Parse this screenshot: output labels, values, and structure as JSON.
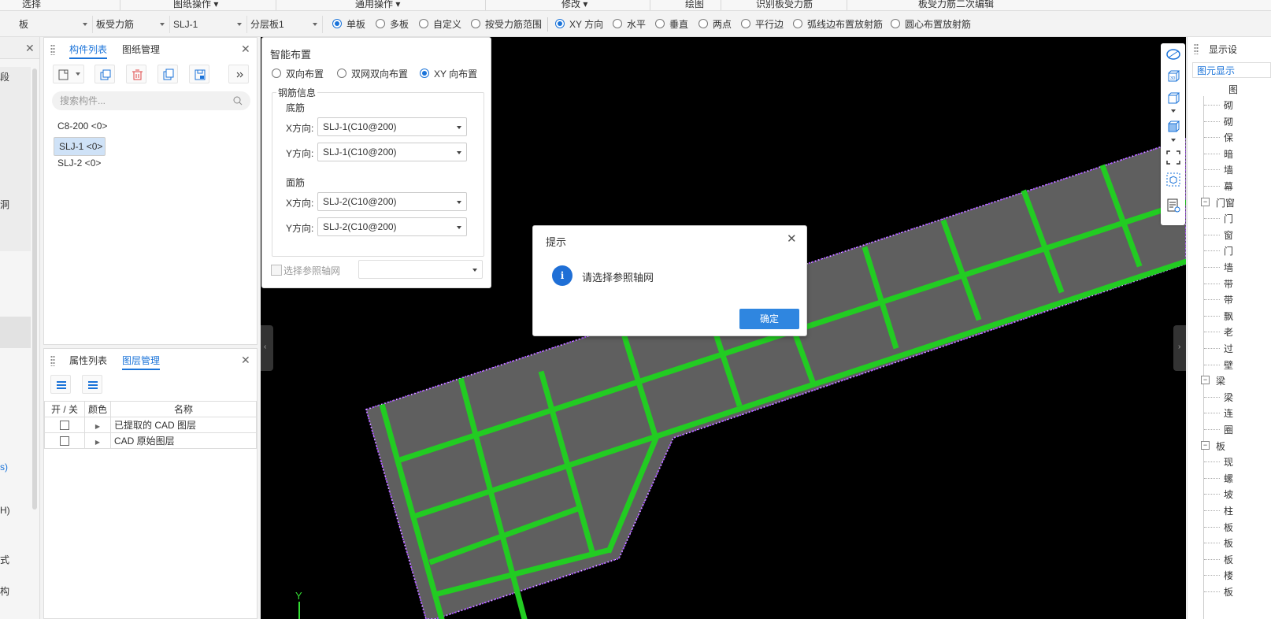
{
  "ribbon": {
    "groups": [
      "选择",
      "图纸操作 ▾",
      "通用操作 ▾",
      "修改 ▾",
      "绘图",
      "识别板受力筋",
      "板受力筋二次编辑"
    ]
  },
  "parambar": {
    "combo1": "板",
    "combo2": "板受力筋",
    "combo3": "SLJ-1",
    "combo4": "分层板1",
    "radios1": [
      {
        "label": "单板",
        "checked": true
      },
      {
        "label": "多板",
        "checked": false
      },
      {
        "label": "自定义",
        "checked": false
      },
      {
        "label": "按受力筋范围",
        "checked": false
      }
    ],
    "radios2": [
      {
        "label": "XY 方向",
        "checked": true
      },
      {
        "label": "水平",
        "checked": false
      },
      {
        "label": "垂直",
        "checked": false
      },
      {
        "label": "两点",
        "checked": false
      },
      {
        "label": "平行边",
        "checked": false
      },
      {
        "label": "弧线边布置放射筋",
        "checked": false
      },
      {
        "label": "圆心布置放射筋",
        "checked": false
      }
    ]
  },
  "leftedge": {
    "texts": [
      "段",
      "洞",
      "s)",
      "H)",
      "式",
      "构"
    ]
  },
  "component_panel": {
    "tab_active": "构件列表",
    "tab_other": "图纸管理",
    "search_placeholder": "搜索构件...",
    "items": [
      "C8-200 <0>",
      "SLJ-1 <0>",
      "SLJ-2 <0>"
    ],
    "selected_index": 1
  },
  "layer_panel": {
    "tab_other": "属性列表",
    "tab_active": "图层管理",
    "headers": [
      "开 / 关",
      "颜色",
      "名称"
    ],
    "rows": [
      "已提取的 CAD 图层",
      "CAD 原始图层"
    ]
  },
  "smart_layout": {
    "title": "智能布置",
    "radios": [
      {
        "label": "双向布置",
        "checked": false
      },
      {
        "label": "双网双向布置",
        "checked": false
      },
      {
        "label": "XY 向布置",
        "checked": true
      }
    ],
    "group_title": "钢筋信息",
    "bottom_title": "底筋",
    "top_title": "面筋",
    "x_label": "X方向:",
    "y_label": "Y方向:",
    "bottom_x": "SLJ-1(C10@200)",
    "bottom_y": "SLJ-1(C10@200)",
    "top_x": "SLJ-2(C10@200)",
    "top_y": "SLJ-2(C10@200)",
    "ref_axis_label": "选择参照轴网",
    "ref_axis_value": ""
  },
  "dialog": {
    "title": "提示",
    "message": "请选择参照轴网",
    "ok": "确定"
  },
  "canvas": {
    "axis_label": "Y",
    "colors": {
      "rebar": "#22cc22",
      "slab": "#5f5f5f",
      "outline": "#a64dff",
      "background": "#000000"
    }
  },
  "right_panel": {
    "title": "显示设",
    "tab": "图元显示",
    "header": "图",
    "rows": [
      "砌",
      "砌",
      "保",
      "暗",
      "墙",
      "幕",
      "门窗",
      "门",
      "窗",
      "门",
      "墙",
      "带",
      "带",
      "飘",
      "老",
      "过",
      "壁",
      "梁",
      "梁",
      "连",
      "圈",
      "板",
      "现",
      "螺",
      "坡",
      "柱",
      "板",
      "板",
      "板",
      "楼",
      "板"
    ],
    "groups": {
      "门窗": "−",
      "梁": "−",
      "板": "−"
    }
  }
}
